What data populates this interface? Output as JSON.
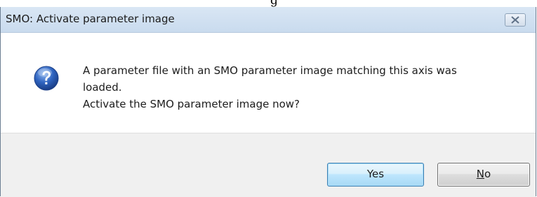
{
  "background_caption": "g",
  "window": {
    "title": "SMO: Activate parameter image",
    "close_icon": "close-icon"
  },
  "message": {
    "icon": "question-icon",
    "line1": "A parameter file with an SMO parameter image matching this axis was",
    "line2": "loaded.",
    "line3": "Activate the SMO parameter image now?"
  },
  "buttons": {
    "yes_label": "Yes",
    "no_mnemonic": "N",
    "no_rest": "o"
  },
  "colors": {
    "titlebar": "#c9dbee",
    "footer": "#f0f0f0",
    "default_button_border": "#3c7fb1",
    "icon_blue": "#2a5db0"
  }
}
